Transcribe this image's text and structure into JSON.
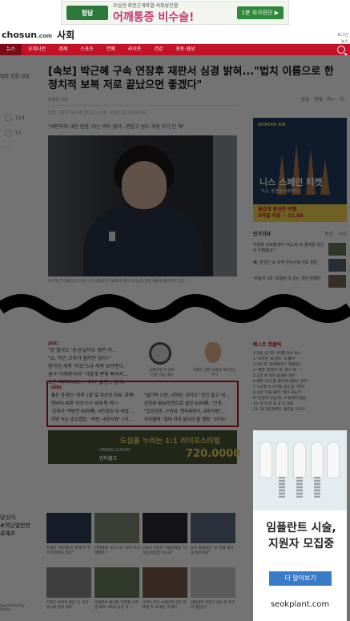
{
  "top_ad": {
    "small": "오십견·회전근개파열·석회성건염",
    "big": "어깨통증 비수술!",
    "logo": "청담",
    "cta": "1분 자가진단 ▶"
  },
  "header": {
    "site": "chosun",
    "site_suffix": ".com",
    "section": "사회",
    "util": "로그인\n뉴스"
  },
  "nav": [
    "뉴스",
    "오피니언",
    "경제",
    "스포츠",
    "연예",
    "라이프",
    "건강",
    "포토·영상"
  ],
  "article": {
    "crumb": "법원·검찰·경찰",
    "headline": "[속보] 박근혜 구속 연장후 재판서 심경 밝혀...\"법치 이름으로 한 정치적 보복 저로 끝났으면 좋겠다\"",
    "byline": "유창욱 기자",
    "tools": [
      "공유",
      "인쇄",
      "가+",
      "가-"
    ],
    "meta": "입력 : 2017.10.16 10:12 | 수정 : 2017.10.16 10:58",
    "lede": "\"재판부에 대한 믿음, 더는 의미 없어...변론고 원드 과정 모기 안 해\"",
    "social": [
      "114",
      "57",
      "···"
    ],
    "caption": "박근혜 전 대통령이 16일 오전 서울중앙지법에서 열린 국정농단 관련 재판에 출석하고 있다."
  },
  "ad_block": {
    "label": "[AD]",
    "text": [
      "\"땀 많아도 '등급'날아도 장면 허...",
      "\"쇼, 작은 고추가 맵지만 많다!\"",
      "점어관,세계 '이것'스냐 세계 보여준다.",
      "꿈극\"거래중이라\" 이렇게 뻔해 빠져서...",
      "로운 하지마세요!\" '이거' 알면... 충격!"
    ],
    "watch_caption": "공정연세 천 200만원 나눔 세일",
    "apple_caption": "비틀린 결린 목통증 바로잡는 주사"
  },
  "red_box": {
    "label": "[AD]",
    "left": [
      "통산 관계전 \"하루 1알\"로 자산과 회복, 화제!",
      "천비리,세계 '이것'스나 세계 몫 작!!!",
      "'은마우' 약방만 50대男, 서민감성 된 비법...",
      "지방 녹는 호소법련, \"숙변, 내장지방\" 1주..."
    ],
    "right": [
      "\"발가락 으면, 사정완, 강아도\" 반간 알고 '어...",
      "은퇴에 월80만원으로 살던 50대男, \"인생...",
      "\"잡은망존, 구관내, 뱃속찌꺼기, 내장지방\"...",
      "주식할때 \"절대 하지 말아야 할 행동\" 3가지!"
    ]
  },
  "banner2": {
    "t1": "도심을 누리는 1:1 라이프스타일",
    "t2": "URBAN LUXURY",
    "t3": "인터불고",
    "t4": "720.0000"
  },
  "left_cut": [
    "당신이",
    "#여당앞만한",
    "료혜츠"
  ],
  "grid": [
    {
      "cap": "트럼프 \"북한에 또 변해 북 주목 전략지도 있다\""
    },
    {
      "cap": "안반대에 '보이스오' 8/하 주거 생활미?"
    },
    {
      "cap": "(속보) 김동연 기술유명합 \"더 이상 협상은 다시요\""
    },
    {
      "cap": "보수 외교발전 \"초 한렬 대선 몫 위주의대\""
    },
    {
      "cap": "지원도 보이지 않은 '순 하기 끝시로 잡게 세바'"
    },
    {
      "cap": "박성현이 태극본 '언제판 고진영 바로 LPGA 성공 가...'"
    },
    {
      "cap": "(단독) 은도 수술만이 5번 '자 포면 주-고색방' 흐레이"
    },
    {
      "cap": "임플란트 비유다 실수 원 부간치 행동은?"
    }
  ],
  "byline_box": "Sponsored by\nDable",
  "right_travel": {
    "k": "KOREAN AIR",
    "title": "니스 스페인 티켓",
    "sub": "지금, 발견을 사랑하다",
    "yel": "즐겁게 풍성한 여행\n5마일 이상 ~ 11.05"
  },
  "popular": {
    "title": "인기기사",
    "tabs": "종합 · 사회",
    "items": [
      "이영학 이씨딸에서 \"어느리 속 경과를 자신이 리에들고\"",
      "美, 흔진인 쇼 지역 군사시설 지도 만든",
      "'무등의 1위' 보급판 대 건는 국민 원했다"
    ]
  },
  "hot": {
    "title": "베스트 핫클릭",
    "rows": [
      "1  처칩 신기한 거미를 알수 되노",
      "2  \"모찬한 '씨 청소' 의 좋이\"",
      "3  자은'여 '반복찌꺼기' 해결이드",
      "4  \"배명 '반복리' 대 '세기 대'...\"",
      "5  고은 손 실모 빛내를 바로\"",
      "6  발연 '금고'를 봉다'에 발표는 본자",
      "7  '2시절 이 구간을 몸의 몸 \"알려\"",
      "8  시양 '마을 때리' '대비 지능기'",
      "9  \"운경에 '전심'에, 비 원에의 함을\"",
      "10  '허 비 진 표 로 더 대표'",
      "11  \"처 자동정력은, 웹도움 '오요'!\""
    ]
  },
  "implant": {
    "headline": "임플란트 시술,\n지원자 모집중",
    "button": "더 알아보기",
    "url": "seokplant.com"
  },
  "colors": {
    "brand_red": "#c2122a",
    "implant_blue": "#3a7bc8"
  }
}
